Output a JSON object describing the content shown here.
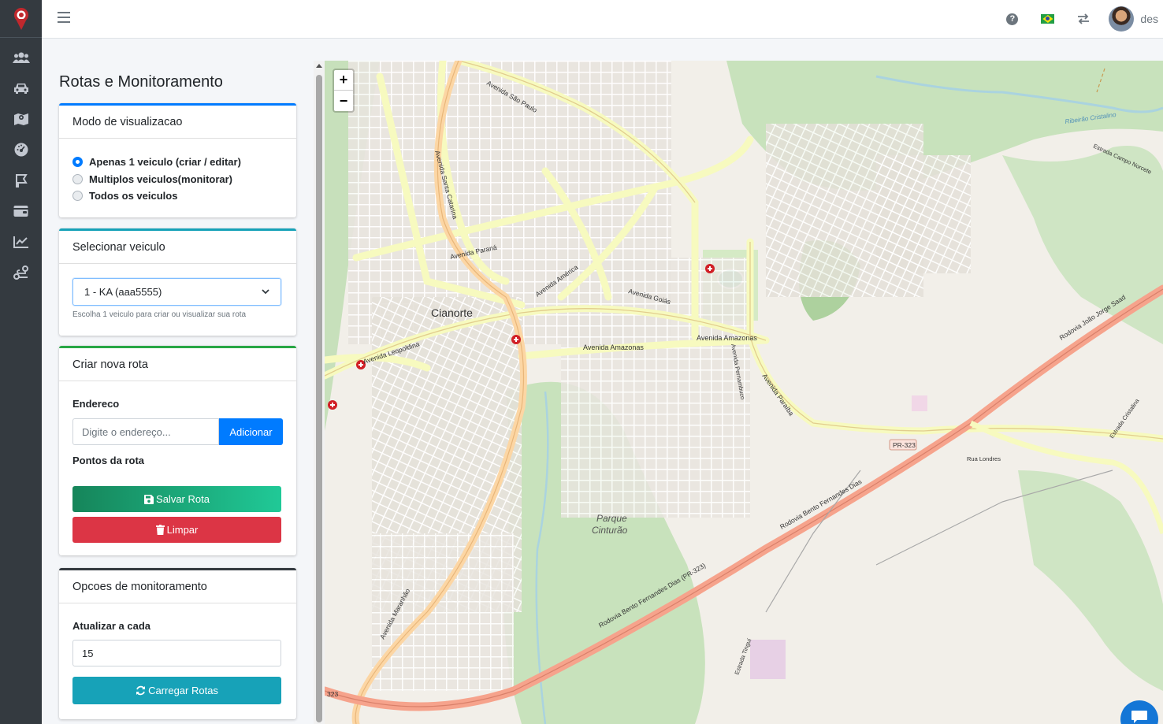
{
  "rail": {
    "items": [
      {
        "icon": "users-icon"
      },
      {
        "icon": "car-icon"
      },
      {
        "icon": "map-icon"
      },
      {
        "icon": "dashboard-icon"
      },
      {
        "icon": "route-icon"
      },
      {
        "icon": "wallet-icon"
      },
      {
        "icon": "chart-line-icon"
      },
      {
        "icon": "route-user-icon"
      }
    ]
  },
  "topbar": {
    "help": "?",
    "username": "des"
  },
  "page": {
    "title": "Rotas e Monitoramento"
  },
  "view_mode": {
    "header": "Modo de visualizacao",
    "options": [
      {
        "label": "Apenas 1 veiculo (criar / editar)",
        "checked": true
      },
      {
        "label": "Multiplos veiculos(monitorar)",
        "checked": false
      },
      {
        "label": "Todos os veiculos",
        "checked": false
      }
    ]
  },
  "vehicle": {
    "header": "Selecionar veiculo",
    "selected": "1 - KA (aaa5555)",
    "help": "Escolha 1 veiculo para criar ou visualizar sua rota"
  },
  "new_route": {
    "header": "Criar nova rota",
    "address_label": "Endereco",
    "address_placeholder": "Digite o endereço...",
    "add_button": "Adicionar",
    "points_label": "Pontos da rota",
    "save_button": "Salvar Rota",
    "clear_button": "Limpar"
  },
  "monitoring": {
    "header": "Opcoes de monitoramento",
    "refresh_label": "Atualizar a cada",
    "refresh_value": "15",
    "load_button": "Carregar Rotas"
  },
  "map": {
    "zoom_in": "+",
    "zoom_out": "−",
    "labels": {
      "city": "Cianorte",
      "park1": "Parque",
      "park2": "Cinturão",
      "av_amazonas": "Avenida Amazonas",
      "av_amazonas2": "Avenida Amazonas",
      "av_parana": "Avenida Paraná",
      "av_goias": "Avenida Goiás",
      "av_america": "Avenida América",
      "av_leopoldina": "Avenida Leopoldina",
      "av_maranhao": "Avenida Maranhão",
      "av_sao_paulo": "Avenida São Paulo",
      "av_santa_catarina": "Avenida Santa Catarina",
      "av_paraiba": "Avenida Paraíba",
      "rod_bfd": "Rodovia Bento Fernandes Dias (PR-323)",
      "rod_bfd2": "Rodovia Bento Fernandes Dias",
      "rod_jjs": "Rodovia João Jorge Saad",
      "pr323": "PR-323",
      "pr323b": "323",
      "ribeirao": "Ribeirão Cristalino",
      "estrada_cn": "Estrada Campo Norcete",
      "av_pernambuco": "Avenida Pernambuco",
      "rua_londres": "Rua Londres",
      "estrada_cristalina": "Estrada Cristalina",
      "estrada_tingui": "Estrada Tinguí"
    }
  }
}
